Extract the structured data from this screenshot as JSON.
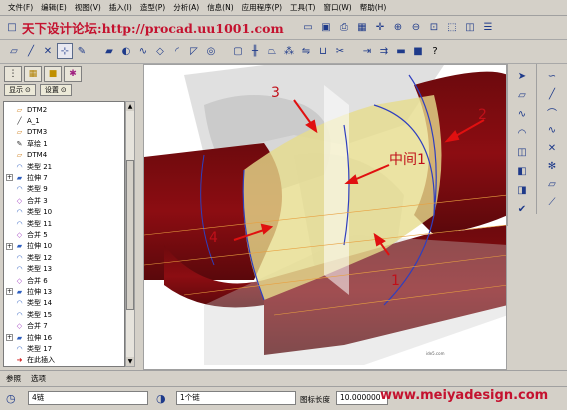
{
  "menu": [
    "文件(F)",
    "编辑(E)",
    "视图(V)",
    "插入(I)",
    "造型(P)",
    "分析(A)",
    "信息(N)",
    "应用程序(P)",
    "工具(T)",
    "窗口(W)",
    "帮助(H)"
  ],
  "watermark_top": "天下设计论坛:http://procad.uu1001.com",
  "watermark_bottom": "www.meiyadesign.com",
  "toolbar_icons": {
    "row1": [
      "new-icon",
      "open-icon",
      "save-icon",
      "print-icon",
      "repaint-icon",
      "spin-center-icon",
      "zoom-in-icon",
      "zoom-out-icon",
      "refit-icon",
      "orient-icon",
      "view-manager-icon",
      "layers-icon"
    ],
    "row2": [
      "datum-plane-icon",
      "datum-axis-icon",
      "datum-point-icon",
      "coordinate-system-icon",
      "sketch-icon",
      "extrude-icon",
      "revolve-icon",
      "sweep-icon",
      "blend-icon",
      "round-icon",
      "chamfer-icon",
      "hole-icon",
      "shell-icon",
      "rib-icon",
      "draft-icon",
      "pattern-icon",
      "mirror-icon",
      "merge-icon",
      "trim-icon",
      "extend-icon",
      "offset-icon",
      "thicken-icon",
      "solidify-icon",
      "help-icon"
    ]
  },
  "model_tree": {
    "tabs": [
      "tree-icon",
      "layers-icon",
      "folder-icon",
      "palette-icon"
    ],
    "show_label": "显示",
    "settings_label": "设置",
    "items": [
      {
        "label": "DTM2",
        "icon": "datum-plane",
        "expand": false
      },
      {
        "label": "A_1",
        "icon": "axis",
        "expand": false
      },
      {
        "label": "DTM3",
        "icon": "datum-plane",
        "expand": false
      },
      {
        "label": "草绘 1",
        "icon": "sketch",
        "expand": false
      },
      {
        "label": "DTM4",
        "icon": "datum-plane",
        "expand": false
      },
      {
        "label": "类型 21",
        "icon": "surface",
        "expand": false
      },
      {
        "label": "拉伸 7",
        "icon": "extrude",
        "expand": true
      },
      {
        "label": "类型 9",
        "icon": "surface",
        "expand": false
      },
      {
        "label": "合并 3",
        "icon": "merge",
        "expand": false
      },
      {
        "label": "类型 10",
        "icon": "surface",
        "expand": false
      },
      {
        "label": "类型 11",
        "icon": "surface",
        "expand": false
      },
      {
        "label": "合并 5",
        "icon": "merge",
        "expand": false
      },
      {
        "label": "拉伸 10",
        "icon": "extrude",
        "expand": true
      },
      {
        "label": "类型 12",
        "icon": "surface",
        "expand": false
      },
      {
        "label": "类型 13",
        "icon": "surface",
        "expand": false
      },
      {
        "label": "合并 6",
        "icon": "merge",
        "expand": false
      },
      {
        "label": "拉伸 13",
        "icon": "extrude",
        "expand": true
      },
      {
        "label": "类型 14",
        "icon": "surface",
        "expand": false
      },
      {
        "label": "类型 15",
        "icon": "surface",
        "expand": false
      },
      {
        "label": "合并 7",
        "icon": "merge",
        "expand": false
      },
      {
        "label": "拉伸 16",
        "icon": "extrude",
        "expand": true
      },
      {
        "label": "类型 17",
        "icon": "surface",
        "expand": false
      },
      {
        "label": "在此插入",
        "icon": "insert-here",
        "expand": false
      }
    ]
  },
  "canvas": {
    "annotations": [
      "1",
      "2",
      "3",
      "4",
      "中间1"
    ],
    "colors": {
      "surface_red": "#8c0d12",
      "surface_yellow": "#e6dc8c",
      "edge_blue": "#2f3fbf",
      "arrow_red": "#e01010",
      "datum_orange": "#e8a040"
    }
  },
  "bottom_tabs": [
    "参照",
    "选项"
  ],
  "status": {
    "chain_field": "4链",
    "chain_count": "1个链",
    "length_label": "图标长度",
    "length_value": "10.000000"
  }
}
